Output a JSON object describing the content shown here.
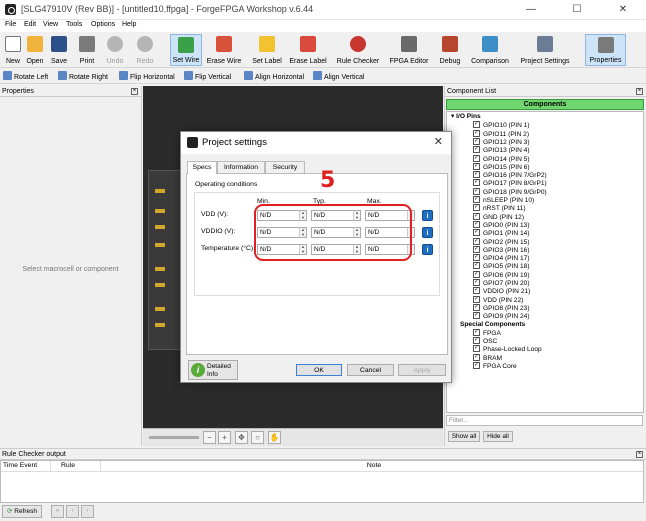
{
  "window": {
    "title": "[SLG47910V (Rev BB)] - [untitled10.ffpga] - ForgeFPGA Workshop v.6.44",
    "controls": [
      "—",
      "☐",
      "✕"
    ]
  },
  "menu": [
    "File",
    "Edit",
    "View",
    "Tools",
    "Options",
    "Help"
  ],
  "toolbar": {
    "buttons": [
      {
        "label": "New",
        "icon": "new-file-icon",
        "color": "#ffffff"
      },
      {
        "label": "Open",
        "icon": "folder-open-icon",
        "color": "#f0b43c"
      },
      {
        "label": "Save",
        "icon": "floppy-save-icon",
        "color": "#2d4f8a"
      },
      {
        "label": "Print",
        "icon": "printer-icon",
        "color": "#7a7a7a"
      },
      {
        "label": "Undo",
        "icon": "undo-icon",
        "color": "#b5b5b5"
      },
      {
        "label": "Redo",
        "icon": "redo-icon",
        "color": "#b5b5b5"
      },
      {
        "label": "Set Wire",
        "icon": "set-wire-icon",
        "color": "#3aa04a"
      },
      {
        "label": "Erase Wire",
        "icon": "erase-wire-icon",
        "color": "#d9533c"
      },
      {
        "label": "Set Label",
        "icon": "tag-label-icon",
        "color": "#f2c230"
      },
      {
        "label": "Erase Label",
        "icon": "erase-label-icon",
        "color": "#d94a3c"
      },
      {
        "label": "Rule Checker",
        "icon": "ladybug-icon",
        "color": "#c8372f"
      },
      {
        "label": "FPGA Editor",
        "icon": "fpga-editor-icon",
        "color": "#6a6a6a"
      },
      {
        "label": "Debug",
        "icon": "debug-icon",
        "color": "#b8462f"
      },
      {
        "label": "Comparison",
        "icon": "comparison-icon",
        "color": "#3c8fc7"
      },
      {
        "label": "Project Settings",
        "icon": "wrench-settings-icon",
        "color": "#6b7d96"
      },
      {
        "label": "Properties",
        "icon": "properties-hammer-icon",
        "color": "#7a7a7a"
      }
    ]
  },
  "toolbar2": [
    "Rotate Left",
    "Rotate Right",
    "Flip Horizontal",
    "Flip Vertical",
    "Align Horizontal",
    "Align Vertical"
  ],
  "properties_panel": {
    "title": "Properties",
    "hint": "Select macrocell or component"
  },
  "component_list": {
    "title": "Component List",
    "header": "Components",
    "groups": [
      {
        "name": "I/O Pins",
        "items": [
          "GPIO10 (PIN 1)",
          "GPIO11 (PIN 2)",
          "GPIO12 (PIN 3)",
          "GPIO13 (PIN 4)",
          "GPIO14 (PIN 5)",
          "GPIO15 (PIN 6)",
          "GPIO16 (PIN 7/GrP2)",
          "GPIO17 (PIN 8/GrP1)",
          "GPIO18 (PIN 9/GrP0)",
          "nSLEEP (PIN 10)",
          "nRST (PIN 11)",
          "GND (PIN 12)",
          "GPIO0 (PIN 13)",
          "GPIO1 (PIN 14)",
          "GPIO2 (PIN 15)",
          "GPIO3 (PIN 16)",
          "GPIO4 (PIN 17)",
          "GPIO5 (PIN 18)",
          "GPIO6 (PIN 19)",
          "GPIO7 (PIN 20)",
          "VDDIO (PIN 21)",
          "VDD (PIN 22)",
          "GPIO8 (PIN 23)",
          "GPIO9 (PIN 24)"
        ]
      },
      {
        "name": "Special Components",
        "items": [
          "FPGA",
          "OSC",
          "Phase-Locked Loop",
          "BRAM",
          "FPGA Core"
        ]
      }
    ],
    "filter_placeholder": "Filter...",
    "show_all": "Show all",
    "hide_all": "Hide all"
  },
  "rule_checker": {
    "title": "Rule Checker output",
    "columns": [
      "Time Event",
      "Rule",
      "Note"
    ],
    "refresh": "Refresh"
  },
  "dialog": {
    "title": "Project settings",
    "tabs": [
      "Specs",
      "Information",
      "Security"
    ],
    "section": "Operating conditions",
    "columns": [
      "Min.",
      "Typ.",
      "Max."
    ],
    "rows": [
      {
        "label": "VDD (V):",
        "min": "N/D",
        "typ": "N/D",
        "max": "N/D"
      },
      {
        "label": "VDDIO (V):",
        "min": "N/D",
        "typ": "N/D",
        "max": "N/D"
      },
      {
        "label": "Temperature (°C):",
        "min": "N/D",
        "typ": "N/D",
        "max": "N/D"
      }
    ],
    "annotation_step": "5",
    "detailed_info": "Detailed Info",
    "ok": "OK",
    "cancel": "Cancel",
    "apply": "Apply"
  },
  "colors": {
    "components_header": "#6fd66f",
    "annotation": "#e02020",
    "info_button": "#1e6fc1"
  }
}
